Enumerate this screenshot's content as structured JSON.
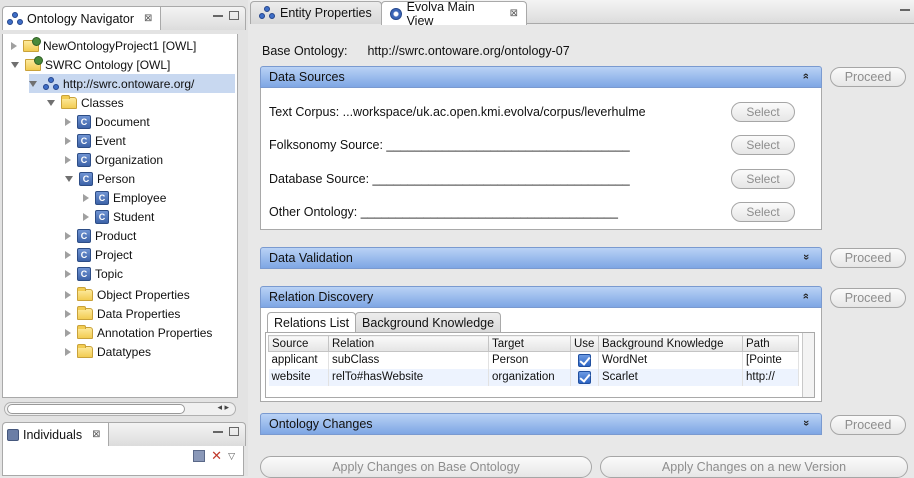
{
  "navigator": {
    "tab_label": "Ontology Navigator",
    "tab_close": "⊠",
    "tree": [
      {
        "label": "NewOntologyProject1 [OWL]"
      },
      {
        "label": "SWRC Ontology [OWL]"
      },
      {
        "label": "http://swrc.ontoware.org/"
      },
      {
        "label": "Classes"
      },
      {
        "label": "Document"
      },
      {
        "label": "Event"
      },
      {
        "label": "Organization"
      },
      {
        "label": "Person"
      },
      {
        "label": "Employee"
      },
      {
        "label": "Student"
      },
      {
        "label": "Product"
      },
      {
        "label": "Project"
      },
      {
        "label": "Topic"
      },
      {
        "label": "Object Properties"
      },
      {
        "label": "Data Properties"
      },
      {
        "label": "Annotation Properties"
      },
      {
        "label": "Datatypes"
      }
    ],
    "class_glyph": "C"
  },
  "individuals": {
    "tab_label": "Individuals",
    "tab_close": "⊠"
  },
  "editor_tabs": [
    {
      "label": "Entity Properties"
    },
    {
      "label": "Evolva Main View",
      "close": "⊠"
    }
  ],
  "base_ontology": {
    "label": "Base Ontology:",
    "value": "http://swrc.ontoware.org/ontology-07"
  },
  "sections": {
    "data_sources": {
      "title": "Data Sources",
      "chevron": "»"
    },
    "data_validation": {
      "title": "Data Validation",
      "chevron": "»"
    },
    "relation_discovery": {
      "title": "Relation Discovery",
      "chevron": "»"
    },
    "ontology_changes": {
      "title": "Ontology Changes",
      "chevron": "»"
    }
  },
  "proceed_label": "Proceed",
  "select_label": "Select",
  "data_sources": [
    {
      "text": "Text Corpus: ...workspace/uk.ac.open.kmi.evolva/corpus/leverhulme"
    },
    {
      "text": "Folksonomy Source: ___________________________________"
    },
    {
      "text": "Database Source: _____________________________________"
    },
    {
      "text": "Other Ontology: _____________________________________"
    }
  ],
  "relation_tabs": [
    {
      "label": "Relations List"
    },
    {
      "label": "Background Knowledge"
    }
  ],
  "relations_table": {
    "headers": [
      "Source",
      "Relation",
      "Target",
      "Use",
      "Background Knowledge",
      "Path"
    ],
    "rows": [
      {
        "source": "applicant",
        "relation": "subClass",
        "target": "Person",
        "bk": "WordNet",
        "path": "[Pointe"
      },
      {
        "source": "website",
        "relation": "relTo#hasWebsite",
        "target": "organization",
        "bk": "Scarlet",
        "path": "http://"
      }
    ]
  },
  "apply_buttons": {
    "base": "Apply Changes on Base Ontology",
    "new_version": "Apply Changes on a new Version"
  },
  "scroll_arrows": "◂ ▸",
  "colors": {
    "section_header_top": "#b9d2f5",
    "section_header_bottom": "#7ea6e4",
    "selection": "#c8d8f0",
    "checkbox": "#2b64c4"
  }
}
